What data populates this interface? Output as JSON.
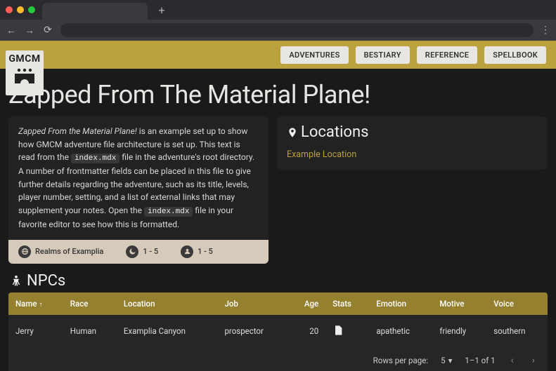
{
  "browser": {
    "newtab_glyph": "+",
    "back_glyph": "←",
    "fwd_glyph": "→",
    "reload_glyph": "⟳",
    "menu_glyph": "⋮"
  },
  "header": {
    "logo_text": "GMCM",
    "nav": [
      "ADVENTURES",
      "BESTIARY",
      "REFERENCE",
      "SPELLBOOK"
    ]
  },
  "page": {
    "title": "Zapped From The Material Plane!",
    "description": {
      "emph": "Zapped From the Material Plane!",
      "p1a": " is an example set up to show how GMCM adventure file architecture is set up. This text is read from the ",
      "code1": "index.mdx",
      "p1b": " file in the adventure's root directory. A number of frontmatter fields can be placed in this file to give further details regarding the adventure, such as its title, levels, player number, setting, and a list of external links that may supplement your notes. Open the ",
      "code2": "index.mdx",
      "p1c": " file in your favorite editor to see how this is formatted."
    },
    "badges": {
      "setting": "Realms of Examplia",
      "levels": "1 - 5",
      "players": "1 - 5"
    },
    "locations": {
      "heading": "Locations",
      "items": [
        "Example Location"
      ]
    },
    "npcs": {
      "heading": "NPCs",
      "columns": [
        "Name",
        "Race",
        "Location",
        "Job",
        "Age",
        "Stats",
        "Emotion",
        "Motive",
        "Voice"
      ],
      "rows": [
        {
          "name": "Jerry",
          "race": "Human",
          "location": "Examplia Canyon",
          "job": "prospector",
          "age": "20",
          "emotion": "apathetic",
          "motive": "friendly",
          "voice": "southern"
        }
      ],
      "pager": {
        "rows_label": "Rows per page:",
        "rows_value": "5",
        "range": "1–1 of 1"
      }
    }
  }
}
